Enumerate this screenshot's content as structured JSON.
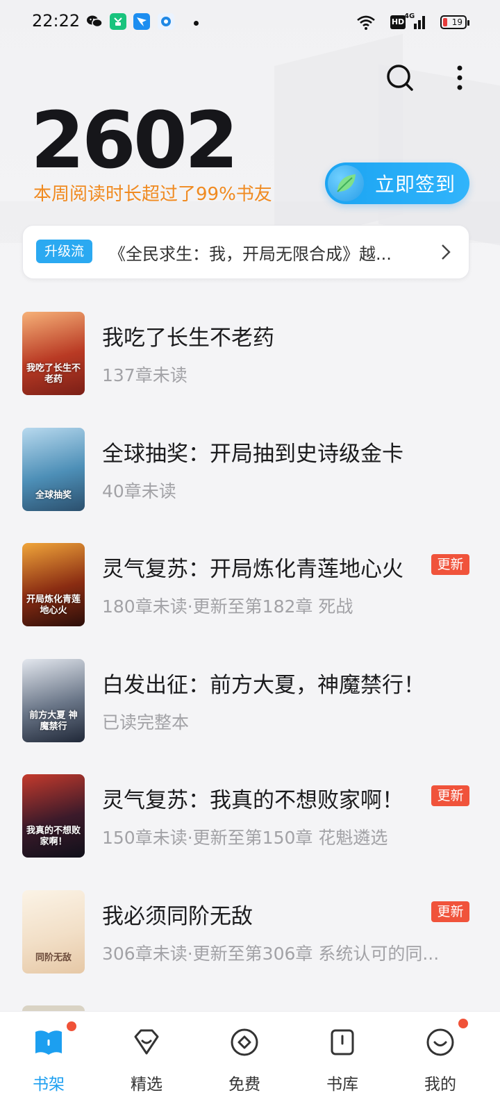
{
  "status_bar": {
    "time": "22:22",
    "battery": "19",
    "hd": "HD",
    "network": "4G",
    "app_icons": [
      "wechat-icon",
      "green-app-icon",
      "blue-app-icon",
      "browser-app-icon"
    ]
  },
  "header": {
    "reading_minutes": "2602",
    "subtitle": "本周阅读时长超过了99%书友",
    "signin_label": "立即签到"
  },
  "notice": {
    "tag": "升级流",
    "text": "《全民求生：我，开局无限合成》越..."
  },
  "books": [
    {
      "title": "我吃了长生不老药",
      "status": "137章未读",
      "badge": "",
      "cover_text": "我吃了长生不老药",
      "cover_colors": [
        "#f6b178",
        "#b93a24",
        "#7a1f17"
      ]
    },
    {
      "title": "全球抽奖：开局抽到史诗级金卡",
      "status": "40章未读",
      "badge": "",
      "cover_text": "全球抽奖",
      "cover_colors": [
        "#b8d9ee",
        "#4d8fb7",
        "#2b4f6d"
      ]
    },
    {
      "title": "灵气复苏：开局炼化青莲地心火",
      "status": "180章未读·更新至第182章 死战",
      "badge": "更新",
      "cover_text": "开局炼化青莲地心火",
      "cover_colors": [
        "#f0a53a",
        "#8a2c12",
        "#2b0e0a"
      ]
    },
    {
      "title": "白发出征：前方大夏，神魔禁行！",
      "status": "已读完整本",
      "badge": "",
      "cover_text": "前方大夏 神魔禁行",
      "cover_colors": [
        "#e3e7ee",
        "#6a7688",
        "#202838"
      ]
    },
    {
      "title": "灵气复苏：我真的不想败家啊！",
      "status": "150章未读·更新至第150章 花魁遴选",
      "badge": "更新",
      "cover_text": "我真的不想败家啊！",
      "cover_colors": [
        "#c43a2c",
        "#3b1a2a",
        "#10101a"
      ]
    },
    {
      "title": "我必须同阶无敌",
      "status": "306章未读·更新至第306章 系统认可的同...",
      "badge": "更新",
      "cover_text": "同阶无敌",
      "cover_colors": [
        "#fbf3e6",
        "#f2dfc7",
        "#e6c8a6"
      ]
    }
  ],
  "tabs": [
    {
      "label": "书架",
      "icon": "bookshelf-icon",
      "active": true,
      "dot": true
    },
    {
      "label": "精选",
      "icon": "featured-icon",
      "active": false,
      "dot": false
    },
    {
      "label": "免费",
      "icon": "free-icon",
      "active": false,
      "dot": false
    },
    {
      "label": "书库",
      "icon": "library-icon",
      "active": false,
      "dot": false
    },
    {
      "label": "我的",
      "icon": "profile-icon",
      "active": false,
      "dot": true
    }
  ],
  "colors": {
    "accent": "#1c9ff0",
    "orange": "#f08a20",
    "badge_red": "#f0533b"
  }
}
